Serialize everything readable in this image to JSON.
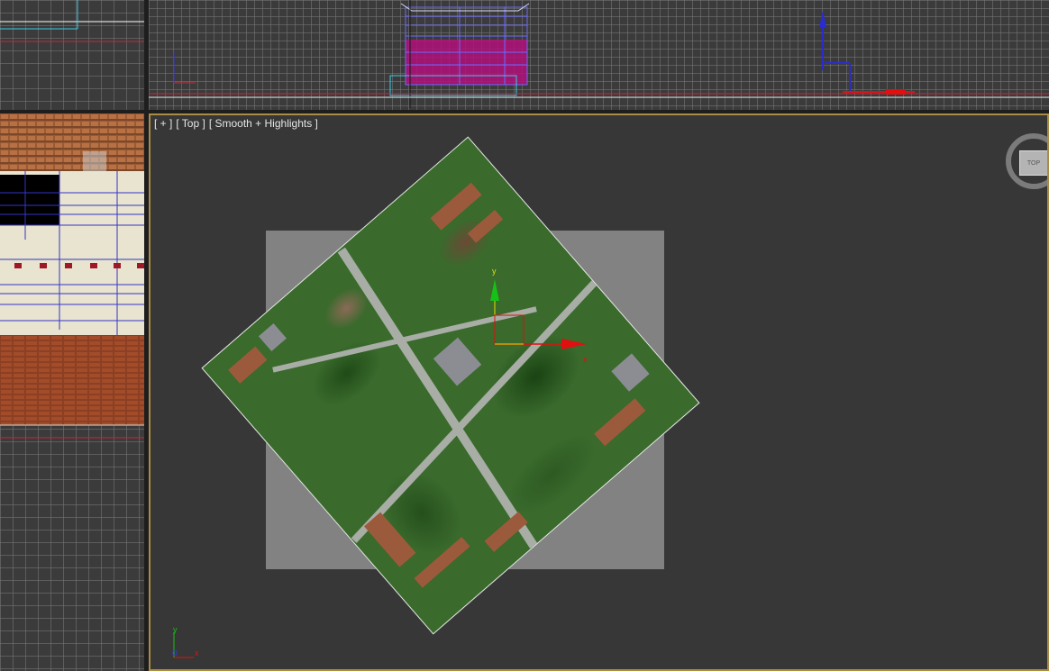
{
  "viewports": {
    "top_left": {
      "name": "top-left-viewport"
    },
    "front": {
      "name": "front-viewport"
    },
    "left": {
      "name": "left-viewport"
    },
    "top": {
      "label_plus": "[ + ]",
      "label_view": "[ Top ]",
      "label_shading": "[ Smooth + Highlights ]",
      "viewcube_face": "TOP",
      "gizmo_x": "x",
      "gizmo_y": "y",
      "corner_axis_x": "x",
      "corner_axis_y": "y"
    }
  },
  "colors": {
    "active_border": "#a98d45",
    "gizmo_x": "#e01010",
    "gizmo_y": "#16c016",
    "selection_magenta": "#b0107a"
  }
}
